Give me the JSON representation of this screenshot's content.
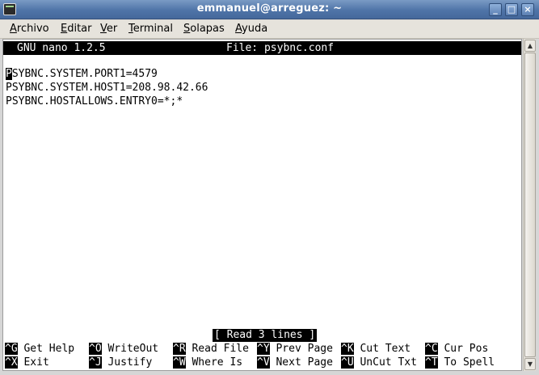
{
  "window": {
    "title": "emmanuel@arreguez: ~",
    "buttons": {
      "minimize": "_",
      "maximize": "□",
      "close": "×"
    }
  },
  "menubar": {
    "items": [
      {
        "label": "Archivo",
        "mnemonic": "A",
        "rest": "rchivo"
      },
      {
        "label": "Editar",
        "mnemonic": "E",
        "rest": "ditar"
      },
      {
        "label": "Ver",
        "mnemonic": "V",
        "rest": "er"
      },
      {
        "label": "Terminal",
        "mnemonic": "T",
        "rest": "erminal"
      },
      {
        "label": "Solapas",
        "mnemonic": "S",
        "rest": "olapas"
      },
      {
        "label": "Ayuda",
        "mnemonic": "A",
        "rest": "yuda"
      }
    ]
  },
  "nano": {
    "version": "GNU nano 1.2.5",
    "file_label": "File: psybnc.conf",
    "cursor_char": "P",
    "lines": [
      "SYBNC.SYSTEM.PORT1=4579",
      "PSYBNC.SYSTEM.HOST1=208.98.42.66",
      "PSYBNC.HOSTALLOWS.ENTRY0=*;*"
    ],
    "status": "[ Read 3 lines ]",
    "shortcuts_row1": [
      {
        "key": "^G",
        "label": "Get Help"
      },
      {
        "key": "^O",
        "label": "WriteOut"
      },
      {
        "key": "^R",
        "label": "Read File"
      },
      {
        "key": "^Y",
        "label": "Prev Page"
      },
      {
        "key": "^K",
        "label": "Cut Text"
      },
      {
        "key": "^C",
        "label": "Cur Pos"
      }
    ],
    "shortcuts_row2": [
      {
        "key": "^X",
        "label": "Exit"
      },
      {
        "key": "^J",
        "label": "Justify"
      },
      {
        "key": "^W",
        "label": "Where Is"
      },
      {
        "key": "^V",
        "label": "Next Page"
      },
      {
        "key": "^U",
        "label": "UnCut Txt"
      },
      {
        "key": "^T",
        "label": "To Spell"
      }
    ]
  },
  "scrollbar": {
    "up": "▲",
    "down": "▼"
  }
}
